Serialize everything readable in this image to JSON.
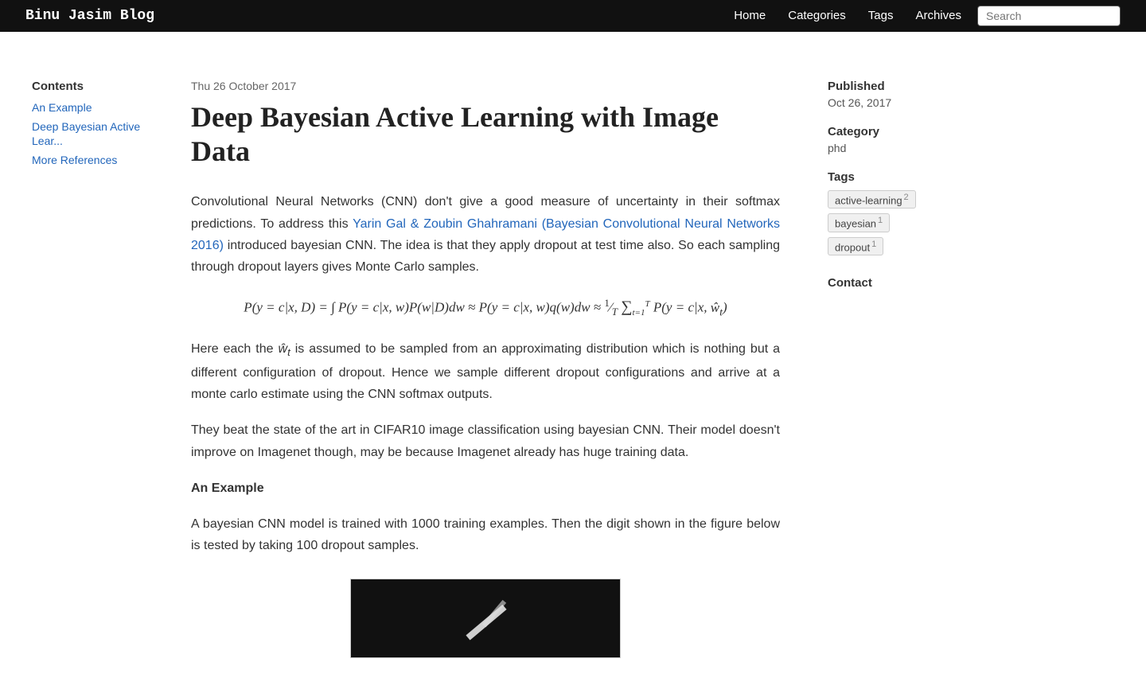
{
  "nav": {
    "brand": "Binu Jasim Blog",
    "links": [
      {
        "label": "Home",
        "href": "#"
      },
      {
        "label": "Categories",
        "href": "#"
      },
      {
        "label": "Tags",
        "href": "#"
      },
      {
        "label": "Archives",
        "href": "#"
      }
    ],
    "search_placeholder": "Search"
  },
  "sidebar_left": {
    "contents_title": "Contents",
    "items": [
      {
        "label": "An Example",
        "href": "#an-example"
      },
      {
        "label": "Deep Bayesian Active Lear...",
        "href": "#deep-bayesian"
      },
      {
        "label": "More References",
        "href": "#more-references"
      }
    ]
  },
  "post": {
    "date": "Thu 26 October 2017",
    "title": "Deep Bayesian Active Learning with Image Data",
    "paragraphs": [
      "Convolutional Neural Networks (CNN) don't give a good measure of uncertainty in their softmax predictions. To address this Yarin Gal & Zoubin Ghahramani (Bayesian Convolutional Neural Networks 2016) introduced bayesian CNN. The idea is that they apply dropout at test time also. So each sampling through dropout layers gives Monte Carlo samples.",
      "Here each the ŵt is assumed to be sampled from an approximating distribution which is nothing but a different configuration of dropout. Hence we sample different dropout configurations and arrive at a monte carlo estimate using the CNN softmax outputs.",
      "They beat the state of the art in CIFAR10 image classification using bayesian CNN. Their model doesn't improve on Imagenet though, may be because Imagenet already has huge training data."
    ],
    "link_text": "Yarin Gal & Zoubin Ghahramani (Bayesian Convolutional Neural Networks 2016)",
    "section_heading": "An Example",
    "example_text": "A bayesian CNN model is trained with 1000 training examples. Then the digit shown in the figure below is tested by taking 100 dropout samples."
  },
  "sidebar_right": {
    "published_label": "Published",
    "published_value": "Oct 26, 2017",
    "category_label": "Category",
    "category_value": "phd",
    "tags_label": "Tags",
    "tags": [
      {
        "name": "active-learning",
        "count": "2"
      },
      {
        "name": "bayesian",
        "count": "1"
      },
      {
        "name": "dropout",
        "count": "1"
      }
    ],
    "contact_label": "Contact"
  }
}
